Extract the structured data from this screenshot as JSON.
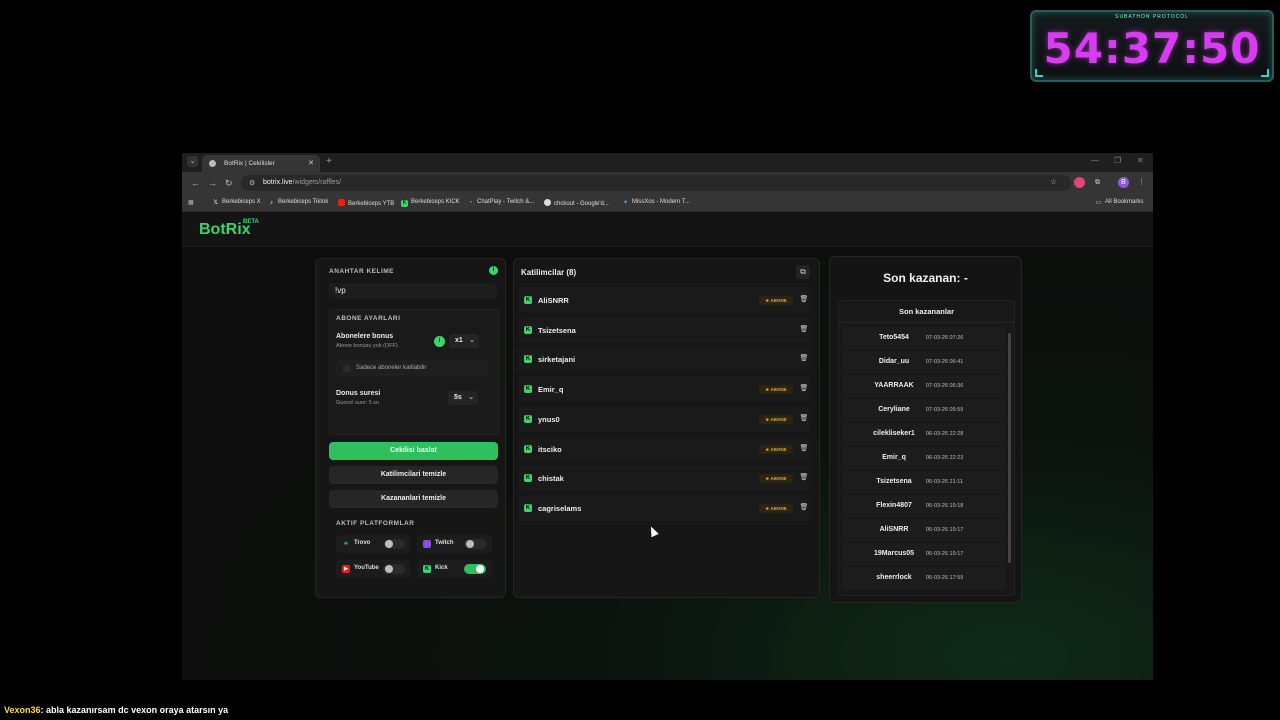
{
  "overlay": {
    "timer_tag": "SUBATHON PROTOCOL",
    "timer": "54:37:50"
  },
  "browser": {
    "tab_title": "BotRix | Cekilisler",
    "url_site": "botrix.live",
    "url_path": "/widgets/raffles/",
    "bookmarks": [
      "Berkebiceps X",
      "Berkebiceps Tiktok",
      "Berkebiceps YTB",
      "Berkebiceps KICK",
      "ChatPlay - Twitch &...",
      "chckout - Google'd...",
      "MissXos - Modern T..."
    ],
    "all_bookmarks": "All Bookmarks",
    "profile_initial": "B"
  },
  "app": {
    "logo": "BotRix",
    "logo_beta": "BETA"
  },
  "left_panel": {
    "keyword_label": "ANAHTAR KELIME",
    "keyword_value": "!vp",
    "sub_settings_label": "ABONE AYARLARI",
    "sub_bonus_title": "Abonelere bonus",
    "sub_bonus_sub": "Abone bonusu yok (OFF)",
    "sub_bonus_value": "x1",
    "sub_only_label": "Sadece aboneler katilabilir",
    "duration_title": "Donus suresi",
    "duration_sub": "Guncel sure: 5 sn",
    "duration_value": "5s",
    "start_button": "Cekilisi baslat",
    "clear_participants": "Katilimcilari temizle",
    "clear_winners": "Kazananlari temizle",
    "platforms_label": "AKTIF PLATFORMLAR",
    "platforms": [
      {
        "name": "Trovo",
        "enabled": false,
        "color": "#1db86a"
      },
      {
        "name": "Twitch",
        "enabled": false,
        "color": "#8a4de8"
      },
      {
        "name": "YouTube",
        "enabled": false,
        "color": "#e62117"
      },
      {
        "name": "Kick",
        "enabled": true,
        "color": "#3ed46c"
      }
    ]
  },
  "participants": {
    "title": "Katilimcilar (8)",
    "badge_label": "ABONE",
    "items": [
      {
        "name": "AliSNRR",
        "subscriber": true
      },
      {
        "name": "Tsizetsena",
        "subscriber": false
      },
      {
        "name": "sirketajani",
        "subscriber": false
      },
      {
        "name": "Emir_q",
        "subscriber": true
      },
      {
        "name": "ynus0",
        "subscriber": true
      },
      {
        "name": "itsciko",
        "subscriber": true
      },
      {
        "name": "chistak",
        "subscriber": true
      },
      {
        "name": "cagriselams",
        "subscriber": true
      }
    ]
  },
  "winners": {
    "last_winner": "Son kazanan: -",
    "header": "Son kazananlar",
    "items": [
      {
        "name": "Teto5454",
        "date": "07-03-26 07:26"
      },
      {
        "name": "Didar_uu",
        "date": "07-03-26 06:41"
      },
      {
        "name": "YAARRAAK",
        "date": "07-03-26 06:36"
      },
      {
        "name": "Ceryliane",
        "date": "07-03-26 05:59"
      },
      {
        "name": "cilekliseker1",
        "date": "06-03-26 22:28"
      },
      {
        "name": "Emir_q",
        "date": "06-03-26 22:23"
      },
      {
        "name": "Tsizetsena",
        "date": "05-03-26 21:11"
      },
      {
        "name": "Flexin4807",
        "date": "05-03-26 19:18"
      },
      {
        "name": "AliSNRR",
        "date": "05-03-26 19:17"
      },
      {
        "name": "19Marcus05",
        "date": "05-03-26 19:17"
      },
      {
        "name": "sheerrlock",
        "date": "05-03-26 17:59"
      }
    ]
  },
  "chat": {
    "user": "Vexon36",
    "message": ": abla kazanırsam dc vexon oraya atarsın ya"
  },
  "colors": {
    "accent": "#3ed46c",
    "timer": "#d63cf0",
    "subscriber_badge": "#d6a83a"
  }
}
